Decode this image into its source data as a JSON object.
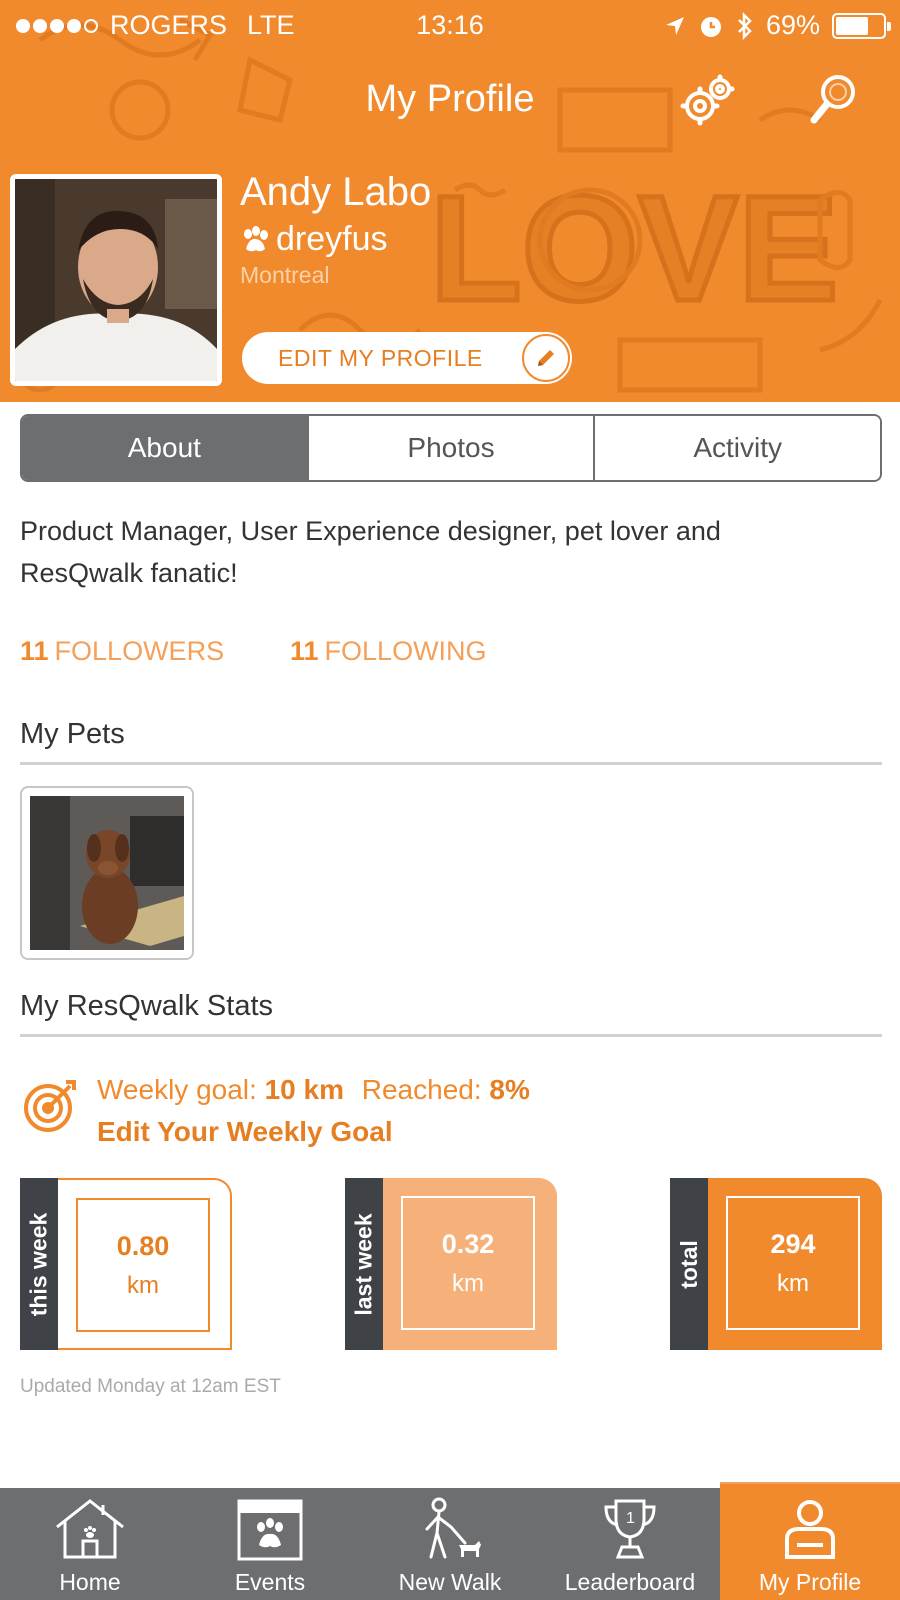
{
  "status_bar": {
    "carrier": "ROGERS",
    "network": "LTE",
    "time": "13:16",
    "battery": "69%",
    "battery_level": 0.69,
    "signal_dots": 5,
    "signal_filled": 4
  },
  "nav": {
    "title": "My Profile",
    "settings_icon": "gears-icon",
    "search_icon": "magnifier-icon"
  },
  "profile": {
    "name": "Andy Labo",
    "pet_handle": "dreyfus",
    "city": "Montreal",
    "edit_label": "EDIT MY PROFILE"
  },
  "tabs": [
    {
      "label": "About",
      "active": true
    },
    {
      "label": "Photos",
      "active": false
    },
    {
      "label": "Activity",
      "active": false
    }
  ],
  "about": {
    "bio_line1": "Product Manager, User Experience designer, pet lover and",
    "bio_line2": "ResQwalk fanatic!",
    "followers_count": "11",
    "followers_label": "FOLLOWERS",
    "following_count": "11",
    "following_label": "FOLLOWING"
  },
  "pets": {
    "title": "My Pets"
  },
  "stats": {
    "title": "My ResQwalk Stats",
    "goal_label": "Weekly goal:",
    "goal_value": "10 km",
    "reached_label": "Reached:",
    "reached_value": "8%",
    "edit_goal": "Edit Your Weekly Goal",
    "cards": [
      {
        "label": "this week",
        "value": "0.80",
        "unit": "km"
      },
      {
        "label": "last week",
        "value": "0.32",
        "unit": "km"
      },
      {
        "label": "total",
        "value": "294",
        "unit": "km"
      }
    ],
    "updated": "Updated Monday at 12am EST"
  },
  "bottom_nav": [
    {
      "label": "Home",
      "icon": "house-icon",
      "active": false
    },
    {
      "label": "Events",
      "icon": "calendar-paw-icon",
      "active": false
    },
    {
      "label": "New Walk",
      "icon": "walker-dog-icon",
      "active": false
    },
    {
      "label": "Leaderboard",
      "icon": "trophy-icon",
      "active": false
    },
    {
      "label": "My Profile",
      "icon": "person-icon",
      "active": true
    }
  ],
  "colors": {
    "brand_orange": "#f18a2c",
    "light_orange": "#f6b07a",
    "dark_gray": "#6d6e70",
    "stat_tab": "#3f4247"
  }
}
